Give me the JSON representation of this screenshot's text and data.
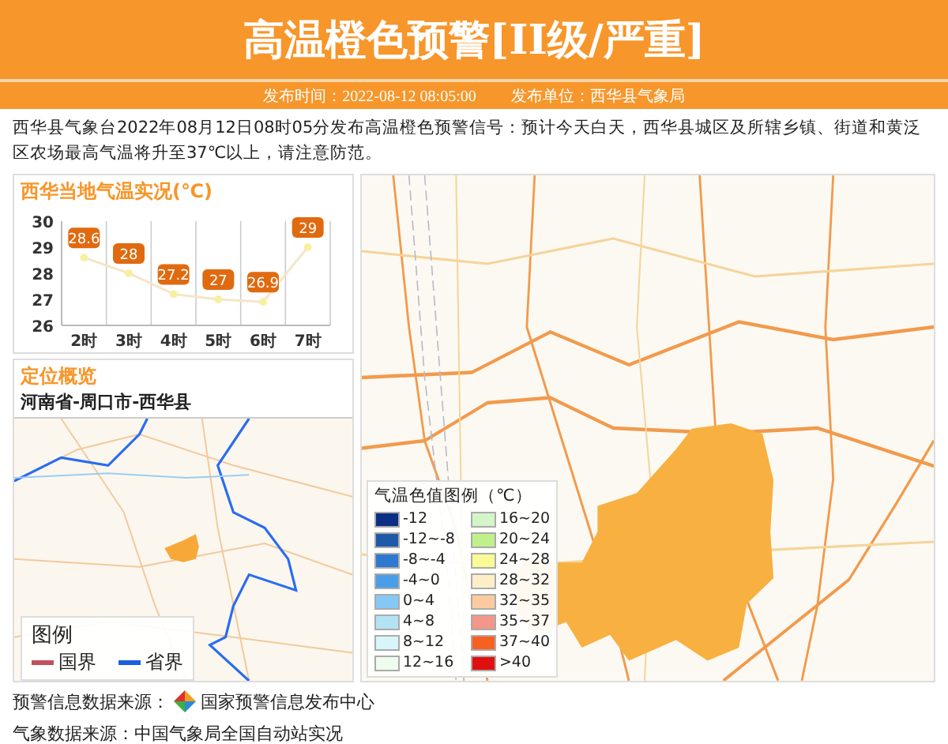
{
  "header": {
    "title": "高温橙色预警[II级/严重]",
    "time_label": "发布时间：2022-08-12 08:05:00",
    "unit_label": "发布单位：西华县气象局"
  },
  "description": "西华县气象台2022年08月12日08时05分发布高温橙色预警信号：预计今天白天，西华县城区及所辖乡镇、街道和黄泛区农场最高气温将升至37℃以上，请注意防范。",
  "temperature_panel": {
    "title": "西华当地气温实况(℃)",
    "chart_data": {
      "type": "line",
      "categories": [
        "2时",
        "3时",
        "4时",
        "5时",
        "6时",
        "7时"
      ],
      "series": [
        {
          "marker": "circle",
          "color": "#f5e6c8",
          "values": [
            28.6,
            28,
            27.2,
            27,
            26.9,
            29
          ]
        }
      ],
      "ylim": [
        26,
        30
      ],
      "yticks": [
        26,
        27,
        28,
        29,
        30
      ],
      "data_labels": true
    }
  },
  "location_panel": {
    "title": "定位概览",
    "region": "河南省-周口市-西华县",
    "legend": {
      "title": "图例",
      "items": [
        {
          "label": "国界",
          "color": "#c0505e"
        },
        {
          "label": "省界",
          "color": "#1a5fe0"
        }
      ]
    }
  },
  "temperature_legend": {
    "title": "气温色值图例（℃）",
    "items": [
      {
        "label": "-12",
        "color": "#0a2f85"
      },
      {
        "label": "-12~-8",
        "color": "#1f5aa8"
      },
      {
        "label": "-8~-4",
        "color": "#2f78d0"
      },
      {
        "label": "-4~0",
        "color": "#4a9ee8"
      },
      {
        "label": "0~4",
        "color": "#86c8f5"
      },
      {
        "label": "4~8",
        "color": "#b4e2f5"
      },
      {
        "label": "8~12",
        "color": "#d8f5fa"
      },
      {
        "label": "12~16",
        "color": "#eefbee"
      },
      {
        "label": "16~20",
        "color": "#d4f5c8"
      },
      {
        "label": "20~24",
        "color": "#c0f08a"
      },
      {
        "label": "24~28",
        "color": "#fafa96"
      },
      {
        "label": "28~32",
        "color": "#fdeec8"
      },
      {
        "label": "32~35",
        "color": "#fbcba0"
      },
      {
        "label": "35~37",
        "color": "#f4968a"
      },
      {
        "label": "37~40",
        "color": "#f86020"
      },
      {
        "label": ">40",
        "color": "#e01010"
      }
    ]
  },
  "footer": {
    "warning_source": "预警信息数据来源：",
    "warning_source_name": "国家预警信息发布中心",
    "weather_source": "气象数据来源：中国气象局全国自动站实况"
  }
}
